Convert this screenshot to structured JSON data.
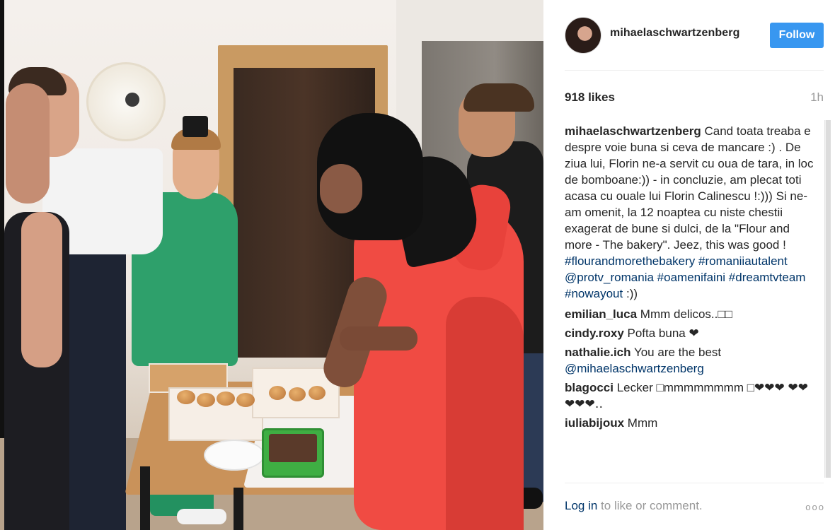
{
  "post": {
    "author": "mihaelaschwartzenberg",
    "follow_label": "Follow",
    "likes": "918 likes",
    "time": "1h"
  },
  "caption": {
    "user": "mihaelaschwartzenberg",
    "text": "Cand toata treaba e despre voie buna si ceva de mancare :) . De ziua lui, Florin ne-a servit cu oua de tara, in loc de bomboane:)) - in concluzie, am plecat toti acasa cu ouale lui Florin Calinescu !:))) Si ne-am omenit, la 12 noaptea cu niste chestii exagerat de bune si dulci, de la \"Flour and more - The bakery\". Jeez, this was good !",
    "hashtags_1": "#flourandmorethebakery",
    "hashtags_2": "#romaniiautalent",
    "mention": "@protv_romania",
    "hashtags_3": "#oamenifaini #dreamtvteam #nowayout",
    "tail": ":))"
  },
  "comments": [
    {
      "user": "emilian_luca",
      "text": "Mmm delicos..□□"
    },
    {
      "user": "cindy.roxy",
      "text": "Pofta buna ❤"
    },
    {
      "user": "nathalie.ich",
      "text": "You are the best",
      "mention": "@mihaelaschwartzenberg"
    },
    {
      "user": "blagocci",
      "text": "Lecker □mmmmmmmm □❤❤❤ ❤❤❤❤❤‥"
    },
    {
      "user": "iuliabijoux",
      "text": "Mmm"
    }
  ],
  "footer": {
    "login": "Log in",
    "rest": " to like or comment.",
    "more": "ooo"
  },
  "colors": {
    "follow_button": "#3897f0",
    "link": "#003569",
    "muted": "#999999",
    "dress": "#f04b43",
    "suit": "#2ea06b"
  },
  "icons": {
    "more_options": "three-dots-icon"
  }
}
